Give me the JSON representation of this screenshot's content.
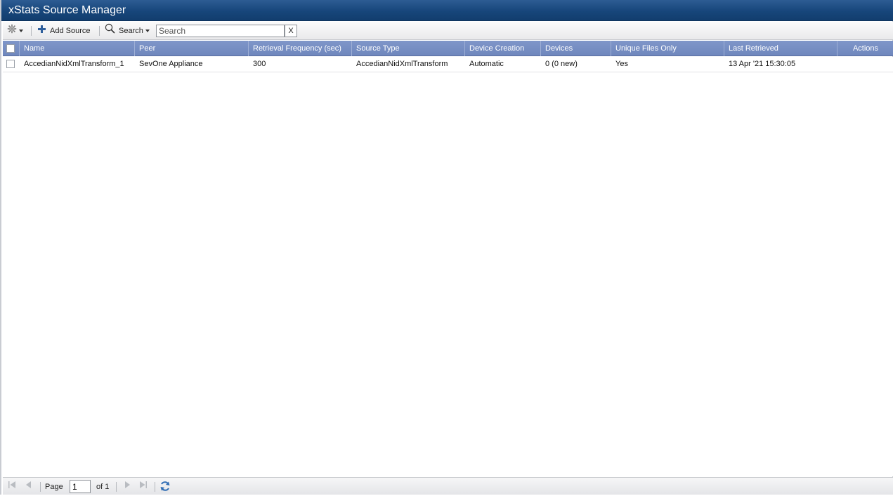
{
  "app": {
    "title": "xStats Source Manager"
  },
  "toolbar": {
    "settings_icon": "gear-icon",
    "add_source_label": "Add Source",
    "search_label": "Search",
    "search_placeholder": "Search",
    "search_value": "",
    "clear_label": "X"
  },
  "table": {
    "columns": [
      "Name",
      "Peer",
      "Retrieval Frequency (sec)",
      "Source Type",
      "Device Creation",
      "Devices",
      "Unique Files Only",
      "Last Retrieved",
      "Actions"
    ],
    "rows": [
      {
        "name": "AccedianNidXmlTransform_1",
        "peer": "SevOne Appliance",
        "retrieval_frequency": "300",
        "source_type": "AccedianNidXmlTransform",
        "device_creation": "Automatic",
        "devices": "0 (0 new)",
        "unique_files_only": "Yes",
        "last_retrieved": "13 Apr '21 15:30:05",
        "actions": ""
      }
    ]
  },
  "pager": {
    "page_label": "Page",
    "page_value": "1",
    "of_label": "of 1"
  }
}
